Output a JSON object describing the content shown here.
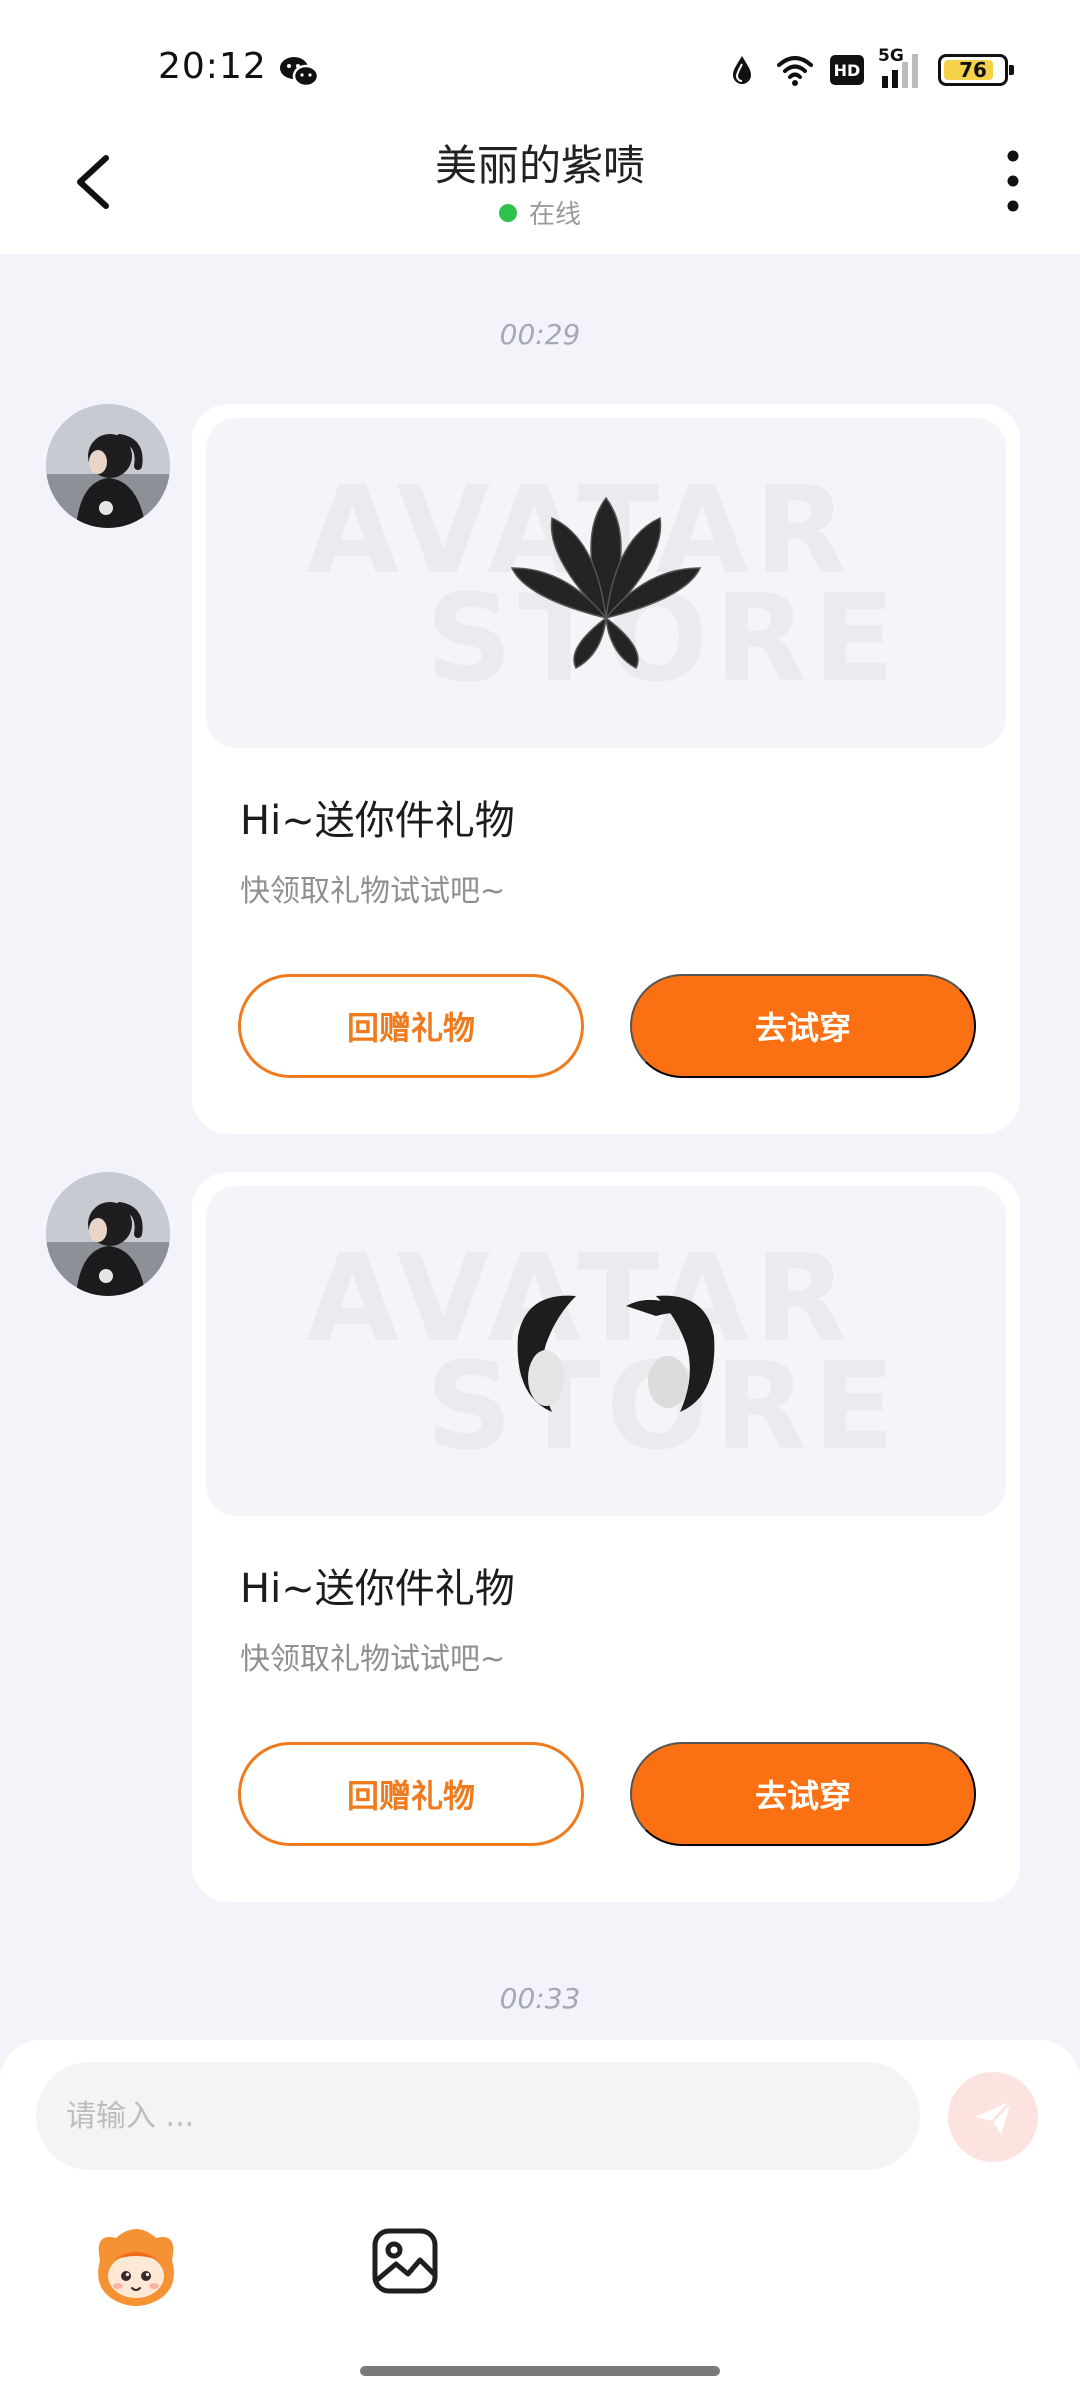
{
  "status_bar": {
    "time": "20:12",
    "signal_label": "5G",
    "hd_label": "HD",
    "battery": "76",
    "icons": [
      "wechat-icon",
      "drop-icon",
      "wifi-icon",
      "hd-icon",
      "signal-icon",
      "battery-icon"
    ]
  },
  "header": {
    "title": "美丽的紫啧",
    "status": "在线",
    "status_color": "#2ec24a",
    "back_icon": "chevron-left-icon",
    "more_icon": "more-vertical-icon"
  },
  "messages": {
    "time_1": "00:29",
    "card_1": {
      "watermark_line1": "AVATAR",
      "watermark_line2": "STORE",
      "item_icon": "black-leaf-hair-accessory",
      "title": "Hi~送你件礼物",
      "subtitle": "快领取礼物试试吧~",
      "return_gift_label": "回赠礼物",
      "try_on_label": "去试穿"
    },
    "card_2": {
      "watermark_line1": "AVATAR",
      "watermark_line2": "STORE",
      "item_icon": "black-ear-muffs-accessory",
      "title": "Hi~送你件礼物",
      "subtitle": "快领取礼物试试吧~",
      "return_gift_label": "回赠礼物",
      "try_on_label": "去试穿"
    },
    "time_2": "00:33"
  },
  "composer": {
    "placeholder": "请输入 ...",
    "send_icon": "send-icon",
    "mascot_icon": "mascot-icon",
    "image_icon": "image-icon"
  },
  "colors": {
    "accent": "#fa7012",
    "background": "#f3f4f9",
    "card": "#ffffff"
  }
}
